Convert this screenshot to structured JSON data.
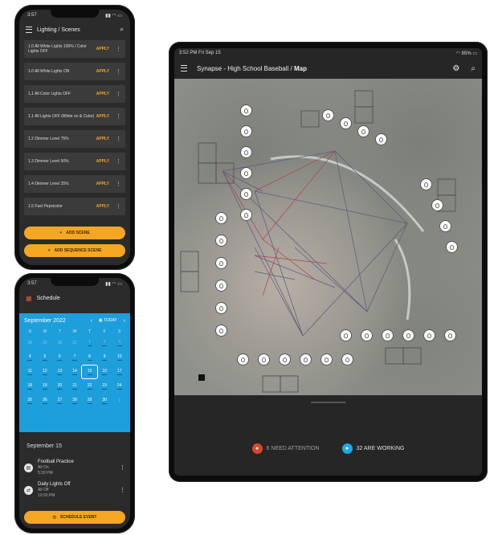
{
  "lighting_phone": {
    "status_time": "3:57",
    "title": "Lighting / Scenes",
    "apply_label": "APPLY",
    "scenes": [
      "1.0 All White Lights 100% / Color Lights OFF",
      "1.0 All White Lights ON",
      "1.1 All Color Lights OFF",
      "1.1 All Lights OFF (White on & Color)",
      "1.2 Dimmer Level 75%",
      "1.3 Dimmer Level 50%",
      "1.4 Dimmer Level 25%",
      "1.5 Fast Pepsicolor"
    ],
    "add_scene_label": "ADD SCENE",
    "add_sequence_label": "ADD SEQUENCE SCENE"
  },
  "schedule_phone": {
    "status_time": "3:57",
    "title": "Schedule",
    "month_label": "September 2022",
    "today_label": "TODAY",
    "days_of_week": [
      "S",
      "M",
      "T",
      "W",
      "T",
      "F",
      "S"
    ],
    "weeks": [
      [
        "28",
        "29",
        "30",
        "31",
        "1",
        "2",
        "3"
      ],
      [
        "4",
        "5",
        "6",
        "7",
        "8",
        "9",
        "10"
      ],
      [
        "11",
        "12",
        "13",
        "14",
        "15",
        "16",
        "17"
      ],
      [
        "18",
        "19",
        "20",
        "21",
        "22",
        "23",
        "24"
      ],
      [
        "25",
        "26",
        "27",
        "28",
        "29",
        "30",
        "1"
      ]
    ],
    "selected_date_label": "September 15",
    "events": [
      {
        "name": "Football Practice",
        "detail": "All On",
        "time": "5:30 PM"
      },
      {
        "name": "Daily Lights Off",
        "detail": "All Off",
        "time": "10:00 PM"
      }
    ],
    "schedule_event_label": "SCHEDULE EVENT"
  },
  "tablet": {
    "status_time": "3:52 PM  Fri Sep 15",
    "status_battery": "85%",
    "breadcrumb_prefix": "Synapse - High School Baseball / ",
    "breadcrumb_current": "Map",
    "need_attention_label": "6 NEED ATTENTION",
    "working_label": "32 ARE WORKING"
  },
  "colors": {
    "accent_orange": "#f5a623",
    "calendar_blue": "#1d9fdb",
    "attention_red": "#d9472b",
    "working_blue": "#1fa8e6"
  }
}
